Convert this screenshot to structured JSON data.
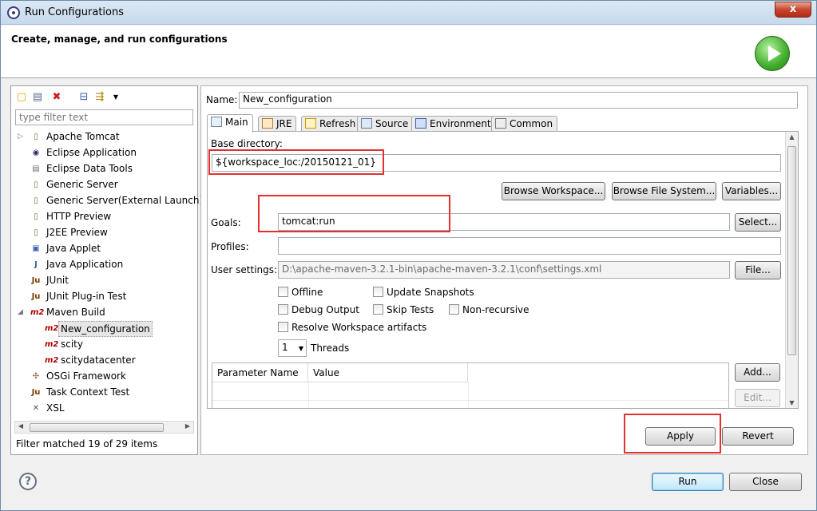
{
  "window": {
    "title": "Run Configurations",
    "close_glyph": "x"
  },
  "banner": {
    "heading": "Create, manage, and run configurations"
  },
  "left": {
    "filter_placeholder": "type filter text",
    "tree": [
      {
        "label": "Apache Tomcat",
        "icon": "server-icon",
        "glyph": "▯",
        "color": "#4f7c3a",
        "expandable": true
      },
      {
        "label": "Eclipse Application",
        "icon": "eclipse-icon",
        "glyph": "◉",
        "color": "#2c2b6b"
      },
      {
        "label": "Eclipse Data Tools",
        "icon": "database-icon",
        "glyph": "▤",
        "color": "#6f6f6f"
      },
      {
        "label": "Generic Server",
        "icon": "server-icon",
        "glyph": "▯",
        "color": "#4f7c3a"
      },
      {
        "label": "Generic Server(External Launch)",
        "icon": "server-icon",
        "glyph": "▯",
        "color": "#4f7c3a"
      },
      {
        "label": "HTTP Preview",
        "icon": "server-icon",
        "glyph": "▯",
        "color": "#4f7c3a"
      },
      {
        "label": "J2EE Preview",
        "icon": "server-icon",
        "glyph": "▯",
        "color": "#4f7c3a"
      },
      {
        "label": "Java Applet",
        "icon": "applet-icon",
        "glyph": "▣",
        "color": "#3b5fa8"
      },
      {
        "label": "Java Application",
        "icon": "java-app-icon",
        "glyph": "J",
        "color": "#3b5fa8"
      },
      {
        "label": "JUnit",
        "icon": "junit-icon",
        "glyph": "Ju",
        "color": "#7a3d00"
      },
      {
        "label": "JUnit Plug-in Test",
        "icon": "junit-plugin-icon",
        "glyph": "Ju",
        "color": "#7a3d00"
      },
      {
        "label": "Maven Build",
        "icon": "maven-icon",
        "glyph": "m2",
        "color": "#b20000",
        "expanded": true
      },
      {
        "label": "New_configuration",
        "icon": "maven-icon",
        "glyph": "m2",
        "color": "#b20000",
        "child": true,
        "selected": true
      },
      {
        "label": "scity",
        "icon": "maven-icon",
        "glyph": "m2",
        "color": "#b20000",
        "child": true
      },
      {
        "label": "scitydatacenter",
        "icon": "maven-icon",
        "glyph": "m2",
        "color": "#b20000",
        "child": true
      },
      {
        "label": "OSGi Framework",
        "icon": "osgi-icon",
        "glyph": "✣",
        "color": "#a0522d"
      },
      {
        "label": "Task Context Test",
        "icon": "task-context-icon",
        "glyph": "Ju",
        "color": "#7a3d00"
      },
      {
        "label": "XSL",
        "icon": "xsl-icon",
        "glyph": "✕",
        "color": "#555555"
      }
    ],
    "status": "Filter matched 19 of 29 items"
  },
  "config": {
    "name_label": "Name:",
    "name_value": "New_configuration",
    "tabs": [
      {
        "label": "Main",
        "icon": "main-tab-icon",
        "active": true
      },
      {
        "label": "JRE",
        "icon": "jre-tab-icon"
      },
      {
        "label": "Refresh",
        "icon": "refresh-tab-icon"
      },
      {
        "label": "Source",
        "icon": "source-tab-icon"
      },
      {
        "label": "Environment",
        "icon": "environment-tab-icon"
      },
      {
        "label": "Common",
        "icon": "common-tab-icon"
      }
    ],
    "base_dir_label": "Base directory:",
    "base_dir_value": "${workspace_loc:/20150121_01}",
    "browse_workspace": "Browse Workspace...",
    "browse_fs": "Browse File System...",
    "variables": "Variables...",
    "goals_label": "Goals:",
    "goals_value": "tomcat:run",
    "select": "Select...",
    "profiles_label": "Profiles:",
    "profiles_value": "",
    "user_settings_label": "User settings:",
    "user_settings_value": "D:\\apache-maven-3.2.1-bin\\apache-maven-3.2.1\\conf\\settings.xml",
    "file": "File...",
    "checks": {
      "offline": "Offline",
      "update_snapshots": "Update Snapshots",
      "debug_output": "Debug Output",
      "skip_tests": "Skip Tests",
      "non_recursive": "Non-recursive",
      "resolve_ws": "Resolve Workspace artifacts"
    },
    "threads_value": "1",
    "threads_label": "Threads",
    "param_headers": [
      "Parameter Name",
      "Value"
    ],
    "add": "Add...",
    "edit": "Edit..."
  },
  "actions": {
    "apply": "Apply",
    "revert": "Revert",
    "run": "Run",
    "close": "Close"
  },
  "colors": {
    "highlight": "#e53030"
  }
}
